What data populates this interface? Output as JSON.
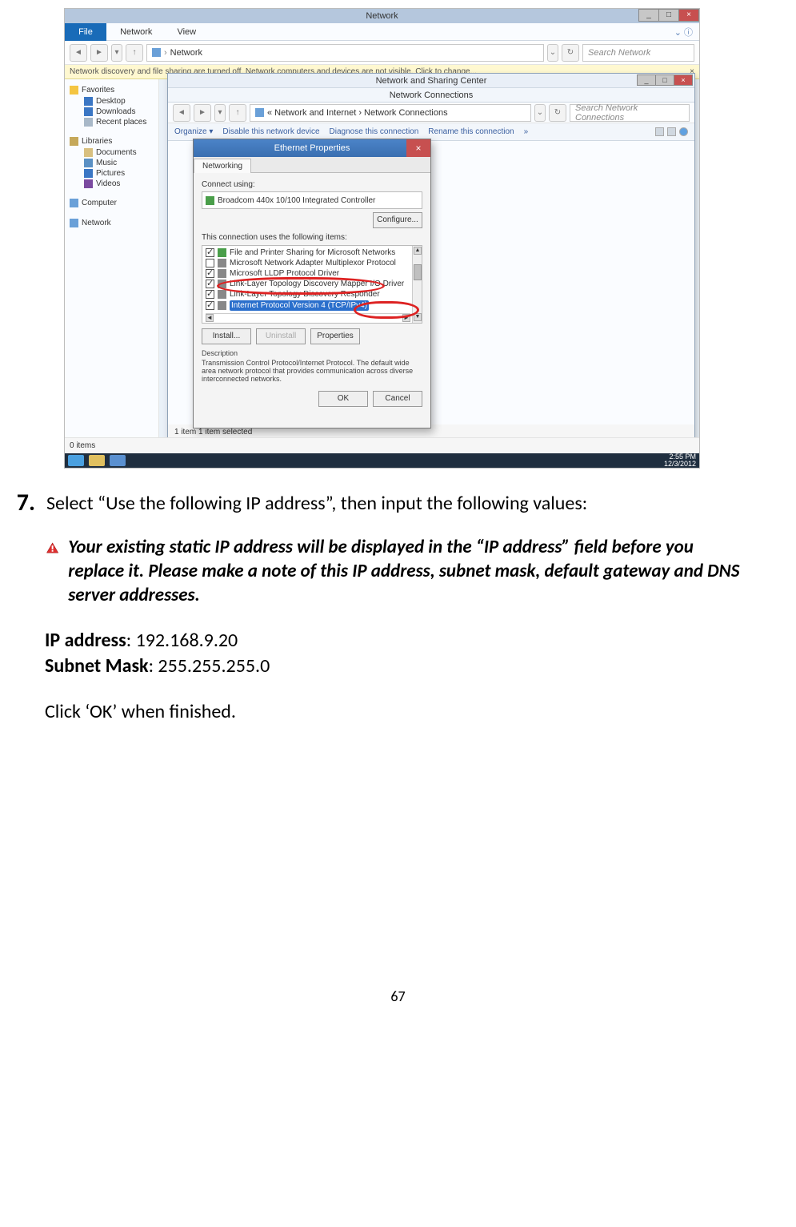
{
  "explorer": {
    "title": "Network",
    "file_tab": "File",
    "tabs": [
      "Network",
      "View"
    ],
    "addr": "Network",
    "search_ph": "Search Network",
    "discover_msg": "Network discovery and file sharing are turned off. Network computers and devices are not visible. Click to change...",
    "status": "0 items"
  },
  "nav": {
    "favorites": "Favorites",
    "fav_items": [
      "Desktop",
      "Downloads",
      "Recent places"
    ],
    "libraries": "Libraries",
    "lib_items": [
      "Documents",
      "Music",
      "Pictures",
      "Videos"
    ],
    "computer": "Computer",
    "network": "Network"
  },
  "nsc": {
    "title": "Network and Sharing Center",
    "sub": "Network Connections",
    "breadcrumb": "« Network and Internet › Network Connections",
    "search_ph": "Search Network Connections",
    "toolbar": [
      "Organize ▾",
      "Disable this network device",
      "Diagnose this connection",
      "Rename this connection",
      "»"
    ],
    "status": "1 item     1 item selected"
  },
  "eth": {
    "title": "Ethernet Properties",
    "tab": "Networking",
    "connect_lbl": "Connect using:",
    "adapter": "Broadcom 440x 10/100 Integrated Controller",
    "configure": "Configure...",
    "uses_lbl": "This connection uses the following items:",
    "items": [
      {
        "chk": true,
        "label": "File and Printer Sharing for Microsoft Networks"
      },
      {
        "chk": false,
        "label": "Microsoft Network Adapter Multiplexor Protocol"
      },
      {
        "chk": true,
        "label": "Microsoft LLDP Protocol Driver"
      },
      {
        "chk": true,
        "label": "Link-Layer Topology Discovery Mapper I/O Driver"
      },
      {
        "chk": true,
        "label": "Link-Layer Topology Discovery Responder"
      },
      {
        "chk": true,
        "label": "Internet Protocol Version 4 (TCP/IPv4)"
      }
    ],
    "install": "Install...",
    "uninstall": "Uninstall",
    "properties": "Properties",
    "desc_lbl": "Description",
    "desc": "Transmission Control Protocol/Internet Protocol. The default wide area network protocol that provides communication across diverse interconnected networks.",
    "ok": "OK",
    "cancel": "Cancel"
  },
  "taskbar": {
    "time": "2:55 PM",
    "date": "12/3/2012"
  },
  "instructions": {
    "step_num": "7.",
    "step_text": "Select “Use the following IP address”, then input the following values:",
    "warn": "Your existing static IP address will be displayed in the “IP address” field before you replace it. Please make a note of this IP address, subnet mask, default gateway and DNS server addresses.",
    "ip_label": "IP address",
    "ip_value": "192.168.9.20",
    "mask_label": "Subnet Mask",
    "mask_value": "255.255.255.0",
    "click_done": "Click ‘OK’ when finished.",
    "page_num": "67"
  }
}
